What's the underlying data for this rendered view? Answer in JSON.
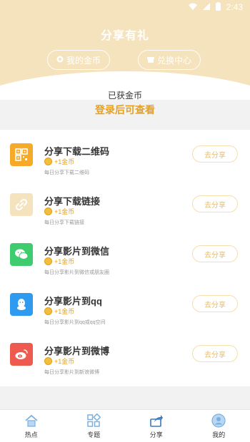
{
  "status_bar": {
    "time": "2:43",
    "icons": [
      "wifi-icon",
      "signal-icon",
      "battery-icon"
    ]
  },
  "header": {
    "title": "分享有礼",
    "my_coins_label": "我的金币",
    "my_coins_icon": "coin-icon",
    "exchange_label": "兑换中心",
    "exchange_icon": "gift-icon"
  },
  "coins": {
    "label": "已获金币",
    "login_prompt": "登录后可查看"
  },
  "tasks": [
    {
      "title": "分享下载二维码",
      "reward": "+1金币",
      "desc": "每日分享下载二维码",
      "button": "去分享",
      "icon": "qrcode-icon",
      "icon_color": "#f7a928"
    },
    {
      "title": "分享下载链接",
      "reward": "+1金币",
      "desc": "每日分享下载链接",
      "button": "去分享",
      "icon": "link-icon",
      "icon_color": "#f5e3bd"
    },
    {
      "title": "分享影片到微信",
      "reward": "+1金币",
      "desc": "每日分享影片到微信或朋友圈",
      "button": "去分享",
      "icon": "wechat-icon",
      "icon_color": "#3fcc6e"
    },
    {
      "title": "分享影片到qq",
      "reward": "+1金币",
      "desc": "每日分享影片到qq或qq空间",
      "button": "去分享",
      "icon": "qq-icon",
      "icon_color": "#2f9bf0"
    },
    {
      "title": "分享影片到微博",
      "reward": "+1金币",
      "desc": "每日分享影片到新浪微博",
      "button": "去分享",
      "icon": "weibo-icon",
      "icon_color": "#ee5a4f"
    }
  ],
  "tabbar": [
    {
      "label": "热点",
      "icon": "home-icon",
      "active": false
    },
    {
      "label": "专题",
      "icon": "grid-icon",
      "active": false
    },
    {
      "label": "分享",
      "icon": "share-icon",
      "active": true
    },
    {
      "label": "我的",
      "icon": "profile-icon",
      "active": false
    }
  ],
  "colors": {
    "header_bg": "#f5e3bd",
    "accent": "#e9a11d",
    "button_border": "#f5dfb0"
  }
}
